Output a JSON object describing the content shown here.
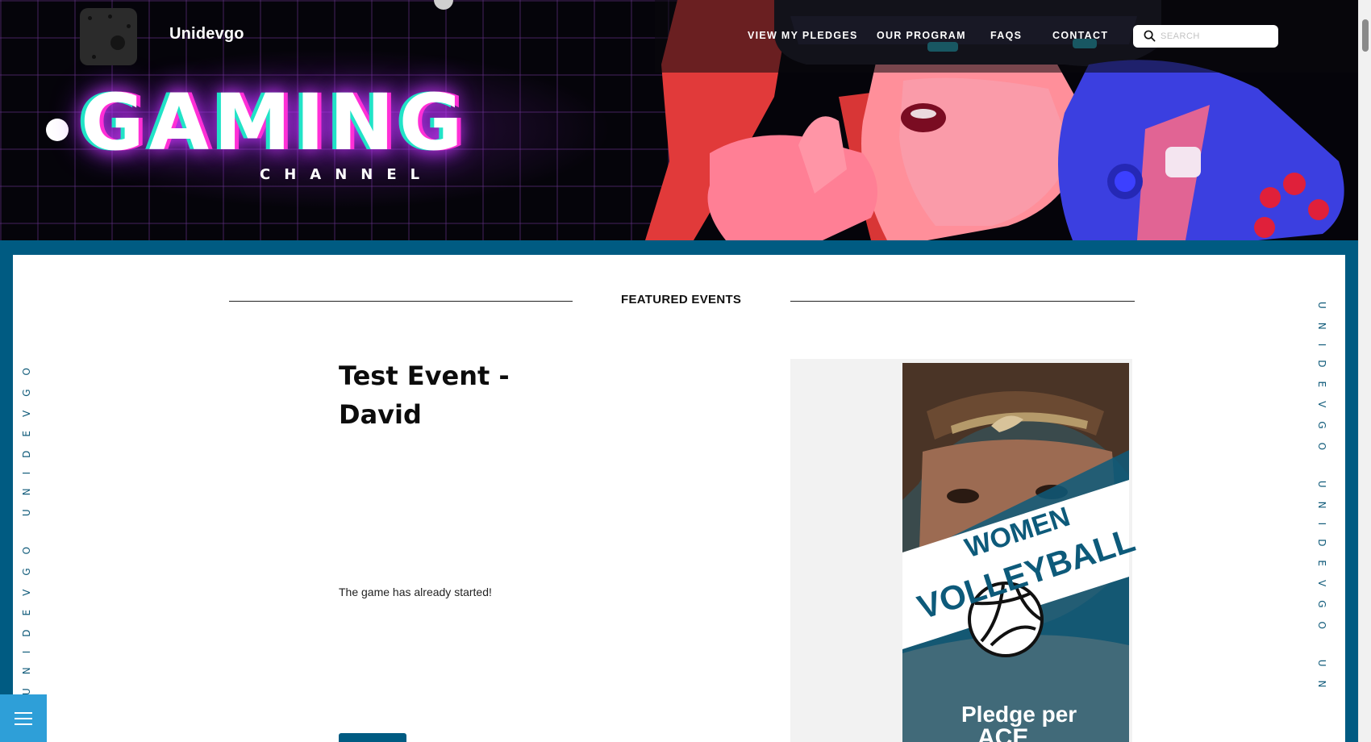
{
  "header": {
    "brand": "Unidevgo",
    "nav": [
      {
        "label": "VIEW MY PLEDGES"
      },
      {
        "label": "OUR PROGRAM"
      },
      {
        "label": "FAQS"
      },
      {
        "label": "CONTACT"
      }
    ],
    "search": {
      "placeholder": "SEARCH",
      "icon": "search-icon"
    }
  },
  "hero": {
    "title": "GAMING",
    "subtitle": "CHANNEL"
  },
  "side_text": {
    "left": "UNIDEVGO UNIDEVGO",
    "right": "UNIDEVGO UNIDEVGO UN"
  },
  "main": {
    "section_title": "FEATURED EVENTS",
    "event": {
      "title": "Test Event - David",
      "status": "The game has already started!"
    },
    "poster": {
      "line1": "WOMEN",
      "line2": "VOLLEYBALL",
      "line3": "Pledge per",
      "line4": "ACE"
    }
  },
  "menu_button": {
    "icon": "hamburger-menu-icon"
  },
  "colors": {
    "frame": "#005b82",
    "hero_bg": "#05040a",
    "menu_button": "#2e9fd8",
    "accent_text": "#0f5a79"
  }
}
